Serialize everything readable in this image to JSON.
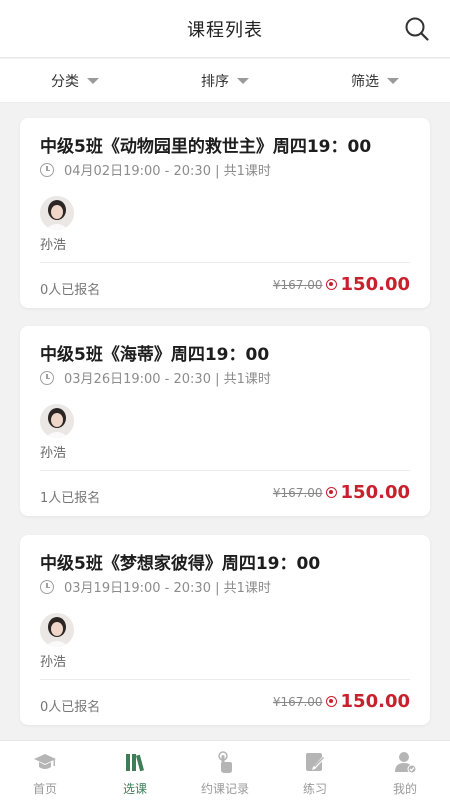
{
  "header": {
    "title": "课程列表"
  },
  "filters": [
    {
      "label": "分类"
    },
    {
      "label": "排序"
    },
    {
      "label": "筛选"
    }
  ],
  "courses": [
    {
      "title": "中级5班《动物园里的救世主》周四19：00",
      "time": "04月02日19:00 - 20:30 | 共1课时",
      "teacher": "孙浩",
      "enrolled": "0人已报名",
      "old_price": "¥167.00",
      "price": "150.00"
    },
    {
      "title": "中级5班《海蒂》周四19：00",
      "time": "03月26日19:00 - 20:30 | 共1课时",
      "teacher": "孙浩",
      "enrolled": "1人已报名",
      "old_price": "¥167.00",
      "price": "150.00"
    },
    {
      "title": "中级5班《梦想家彼得》周四19：00",
      "time": "03月19日19:00 - 20:30 | 共1课时",
      "teacher": "孙浩",
      "enrolled": "0人已报名",
      "old_price": "¥167.00",
      "price": "150.00"
    }
  ],
  "tabbar": [
    {
      "label": "首页",
      "icon": "graduation-cap-icon",
      "active": false
    },
    {
      "label": "选课",
      "icon": "books-icon",
      "active": true
    },
    {
      "label": "约课记录",
      "icon": "tap-hand-icon",
      "active": false
    },
    {
      "label": "练习",
      "icon": "pencil-note-icon",
      "active": false
    },
    {
      "label": "我的",
      "icon": "user-icon",
      "active": false
    }
  ],
  "colors": {
    "accent": "#3f7d57",
    "price": "#c8202c",
    "background": "#f2f2f2"
  }
}
